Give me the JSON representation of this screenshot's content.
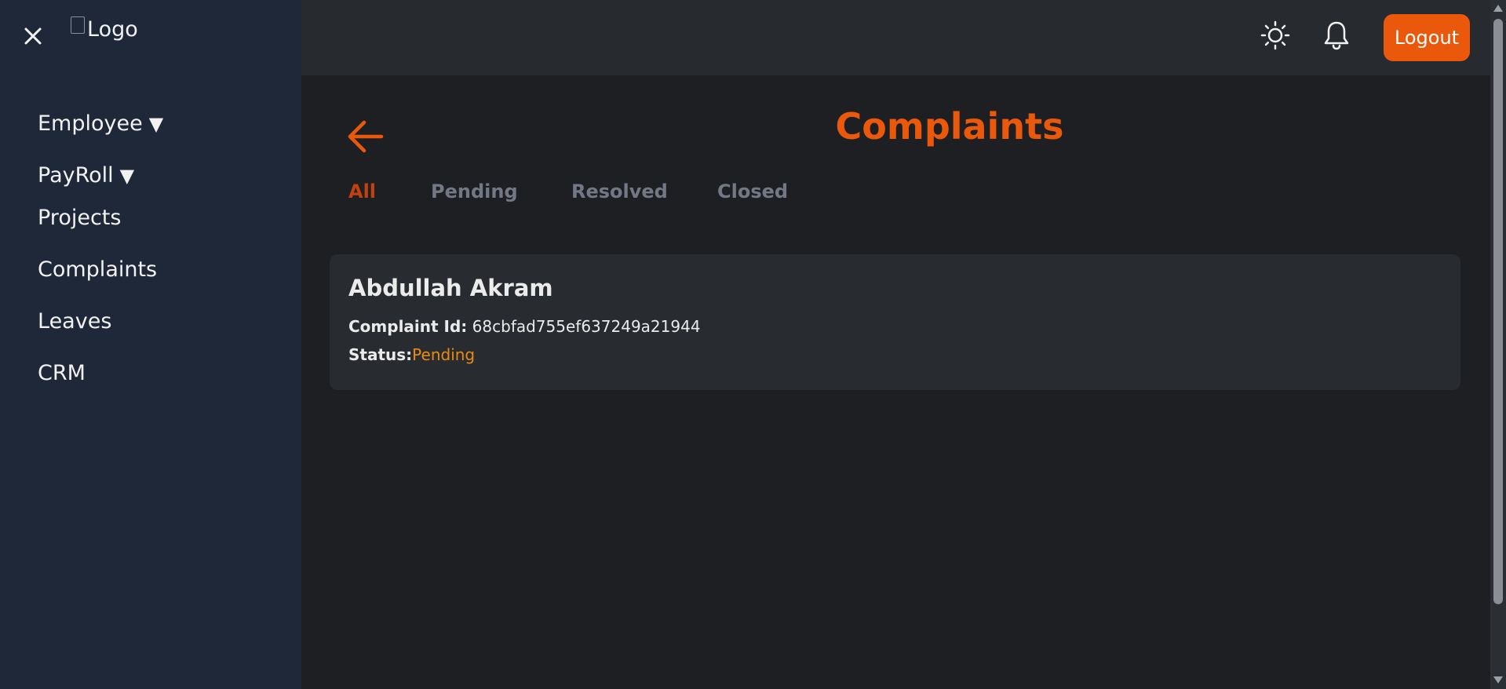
{
  "sidebar": {
    "logo_alt": "Logo",
    "items": [
      {
        "label": "Employee",
        "caret": "▼"
      },
      {
        "label": "PayRoll",
        "caret": "▼"
      },
      {
        "label": "Projects"
      },
      {
        "label": "Complaints"
      },
      {
        "label": "Leaves"
      },
      {
        "label": "CRM"
      }
    ]
  },
  "header": {
    "logout_label": "Logout",
    "icons": [
      "sun-icon",
      "bell-icon",
      "close-icon",
      "back-arrow-icon"
    ]
  },
  "main": {
    "title": "Complaints",
    "tabs": [
      {
        "label": "All",
        "active": true
      },
      {
        "label": "Pending"
      },
      {
        "label": "Resolved"
      },
      {
        "label": "Closed"
      }
    ],
    "complaints": [
      {
        "name": "Abdullah Akram",
        "id_label": "Complaint Id:",
        "id_value": "68cbfad755ef637249a21944",
        "status_label": "Status:",
        "status_value": "Pending"
      }
    ]
  },
  "colors": {
    "accent": "#ea580c",
    "active_tab": "#c2410c",
    "status_pending": "#ea8b10",
    "sidebar_bg": "#1f2838",
    "topbar_bg": "#272a2e",
    "page_bg": "#1d1f23",
    "card_bg": "#282b30"
  }
}
